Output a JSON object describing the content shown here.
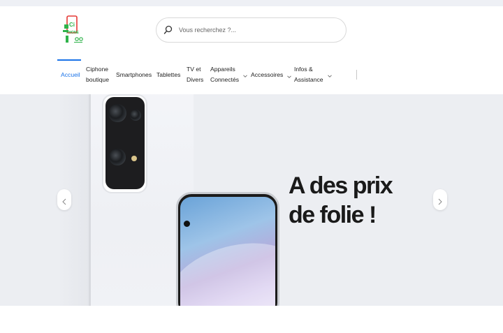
{
  "header": {
    "logo_icon": "ciphone-logo-icon",
    "search": {
      "placeholder": "Vous recherchez ?...",
      "value": "",
      "icon": "search-icon"
    }
  },
  "nav": {
    "items": [
      {
        "line1": "Accueil",
        "line2": "",
        "active": true,
        "has_dropdown": false
      },
      {
        "line1": "Ciphone",
        "line2": "boutique",
        "active": false,
        "has_dropdown": false
      },
      {
        "line1": "Smartphones",
        "line2": "",
        "active": false,
        "has_dropdown": false
      },
      {
        "line1": "Tablettes",
        "line2": "",
        "active": false,
        "has_dropdown": false
      },
      {
        "line1": "TV et",
        "line2": "Divers",
        "active": false,
        "has_dropdown": false
      },
      {
        "line1": "Appareils",
        "line2": "Connectés",
        "active": false,
        "has_dropdown": true
      },
      {
        "line1": "Accessoires",
        "line2": "",
        "active": false,
        "has_dropdown": true
      },
      {
        "line1": "Infos &",
        "line2": "Assistance",
        "active": false,
        "has_dropdown": true
      }
    ]
  },
  "hero": {
    "title_line1": "A des prix",
    "title_line2": "de folie !",
    "prev_icon": "chevron-left-icon",
    "next_icon": "chevron-right-icon"
  },
  "colors": {
    "accent": "#1a73e8",
    "hero_bg": "#eceef2",
    "logo_green": "#2fb34a",
    "logo_red": "#e53935"
  }
}
